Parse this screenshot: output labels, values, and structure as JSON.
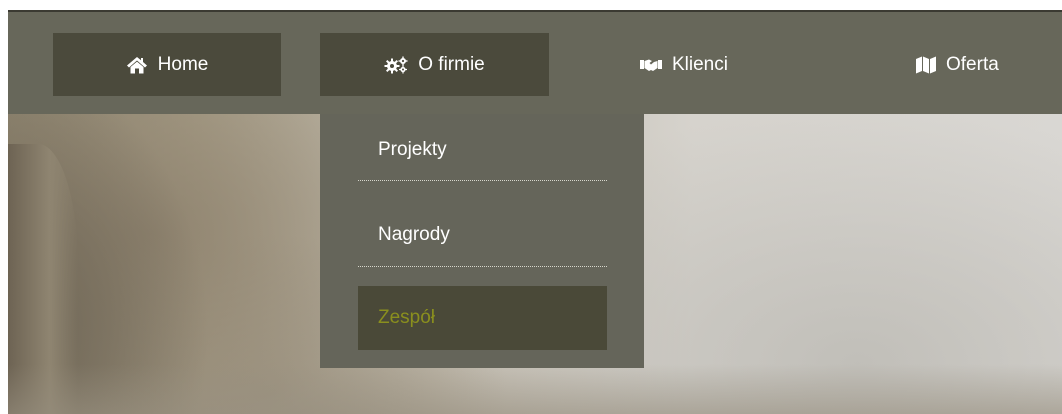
{
  "nav": {
    "items": [
      {
        "label": "Home",
        "icon": "home-icon"
      },
      {
        "label": "O firmie",
        "icon": "gears-icon"
      },
      {
        "label": "Klienci",
        "icon": "handshake-icon"
      },
      {
        "label": "Oferta",
        "icon": "map-icon"
      }
    ]
  },
  "dropdown": {
    "items": [
      {
        "label": "Projekty"
      },
      {
        "label": "Nagrody"
      },
      {
        "label": "Zespół",
        "active": true
      }
    ]
  },
  "colors": {
    "navbar": "#67675a",
    "nav_item_active": "#4b4a3c",
    "dropdown": "#65655a",
    "dropdown_active_bg": "#4a4938",
    "dropdown_active_text": "#8a8f1e",
    "text": "#ffffff"
  }
}
